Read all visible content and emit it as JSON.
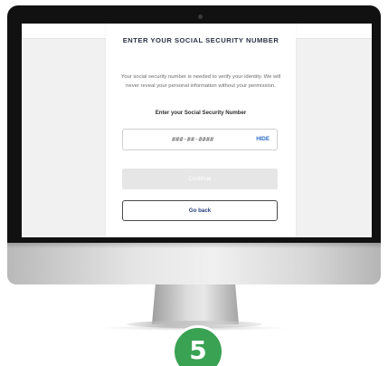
{
  "form": {
    "title": "ENTER YOUR SOCIAL SECURITY NUMBER",
    "description": "Your social security number is needed to verify your identity. We will never reveal your personal information without your permission.",
    "field_label": "Enter your Social Security Number",
    "ssn_placeholder": "###-##-####",
    "ssn_value": "",
    "hide_label": "HIDE",
    "continue_label": "Continue",
    "back_label": "Go back"
  },
  "step_badge": {
    "number": "5"
  },
  "colors": {
    "accent_link": "#2f6cc4",
    "badge_green": "#39a253",
    "disabled_button": "#e6e6e6"
  }
}
